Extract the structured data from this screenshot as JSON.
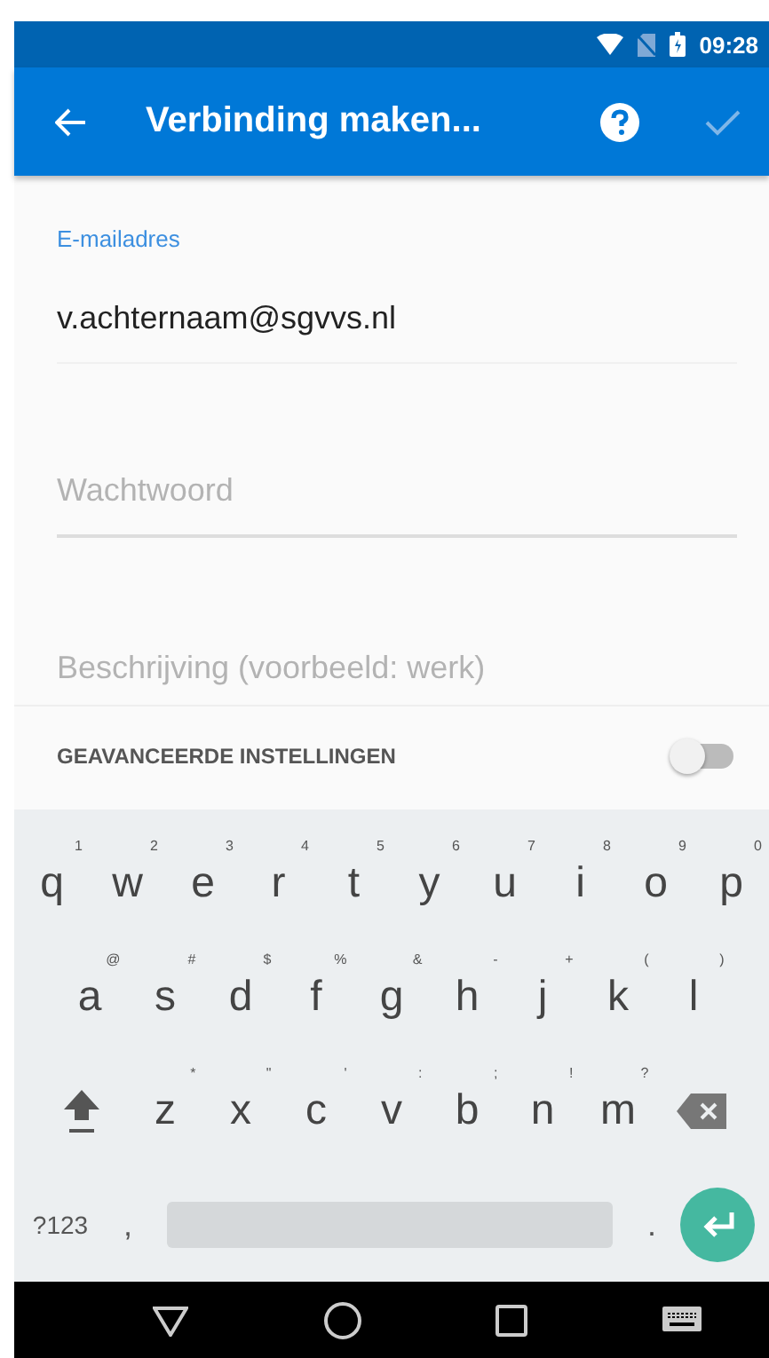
{
  "status_bar": {
    "time": "09:28"
  },
  "app_bar": {
    "title": "Verbinding maken..."
  },
  "fields": [
    {
      "label": "E-mailadres",
      "value": "v.achternaam@sgvvs.nl"
    },
    {
      "placeholder": "Wachtwoord"
    },
    {
      "placeholder": "Beschrijving (voorbeeld: werk)"
    }
  ],
  "advanced": {
    "label": "GEAVANCEERDE INSTELLINGEN",
    "on": false
  },
  "keyboard": {
    "rows": [
      [
        {
          "label": "q",
          "hint": "1"
        },
        {
          "label": "w",
          "hint": "2"
        },
        {
          "label": "e",
          "hint": "3"
        },
        {
          "label": "r",
          "hint": "4"
        },
        {
          "label": "t",
          "hint": "5"
        },
        {
          "label": "y",
          "hint": "6"
        },
        {
          "label": "u",
          "hint": "7"
        },
        {
          "label": "i",
          "hint": "8"
        },
        {
          "label": "o",
          "hint": "9"
        },
        {
          "label": "p",
          "hint": "0"
        }
      ],
      [
        {
          "label": "a",
          "hint": "@"
        },
        {
          "label": "s",
          "hint": "#"
        },
        {
          "label": "d",
          "hint": "$"
        },
        {
          "label": "f",
          "hint": "%"
        },
        {
          "label": "g",
          "hint": "&"
        },
        {
          "label": "h",
          "hint": "-"
        },
        {
          "label": "j",
          "hint": "+"
        },
        {
          "label": "k",
          "hint": "("
        },
        {
          "label": "l",
          "hint": ")"
        }
      ],
      [
        {
          "label": "z",
          "hint": "*"
        },
        {
          "label": "x",
          "hint": "\""
        },
        {
          "label": "c",
          "hint": "'"
        },
        {
          "label": "v",
          "hint": ":"
        },
        {
          "label": "b",
          "hint": ";"
        },
        {
          "label": "n",
          "hint": "!"
        },
        {
          "label": "m",
          "hint": "?"
        }
      ]
    ],
    "symbols_key": "?123",
    "comma_key": ",",
    "period_key": "."
  }
}
